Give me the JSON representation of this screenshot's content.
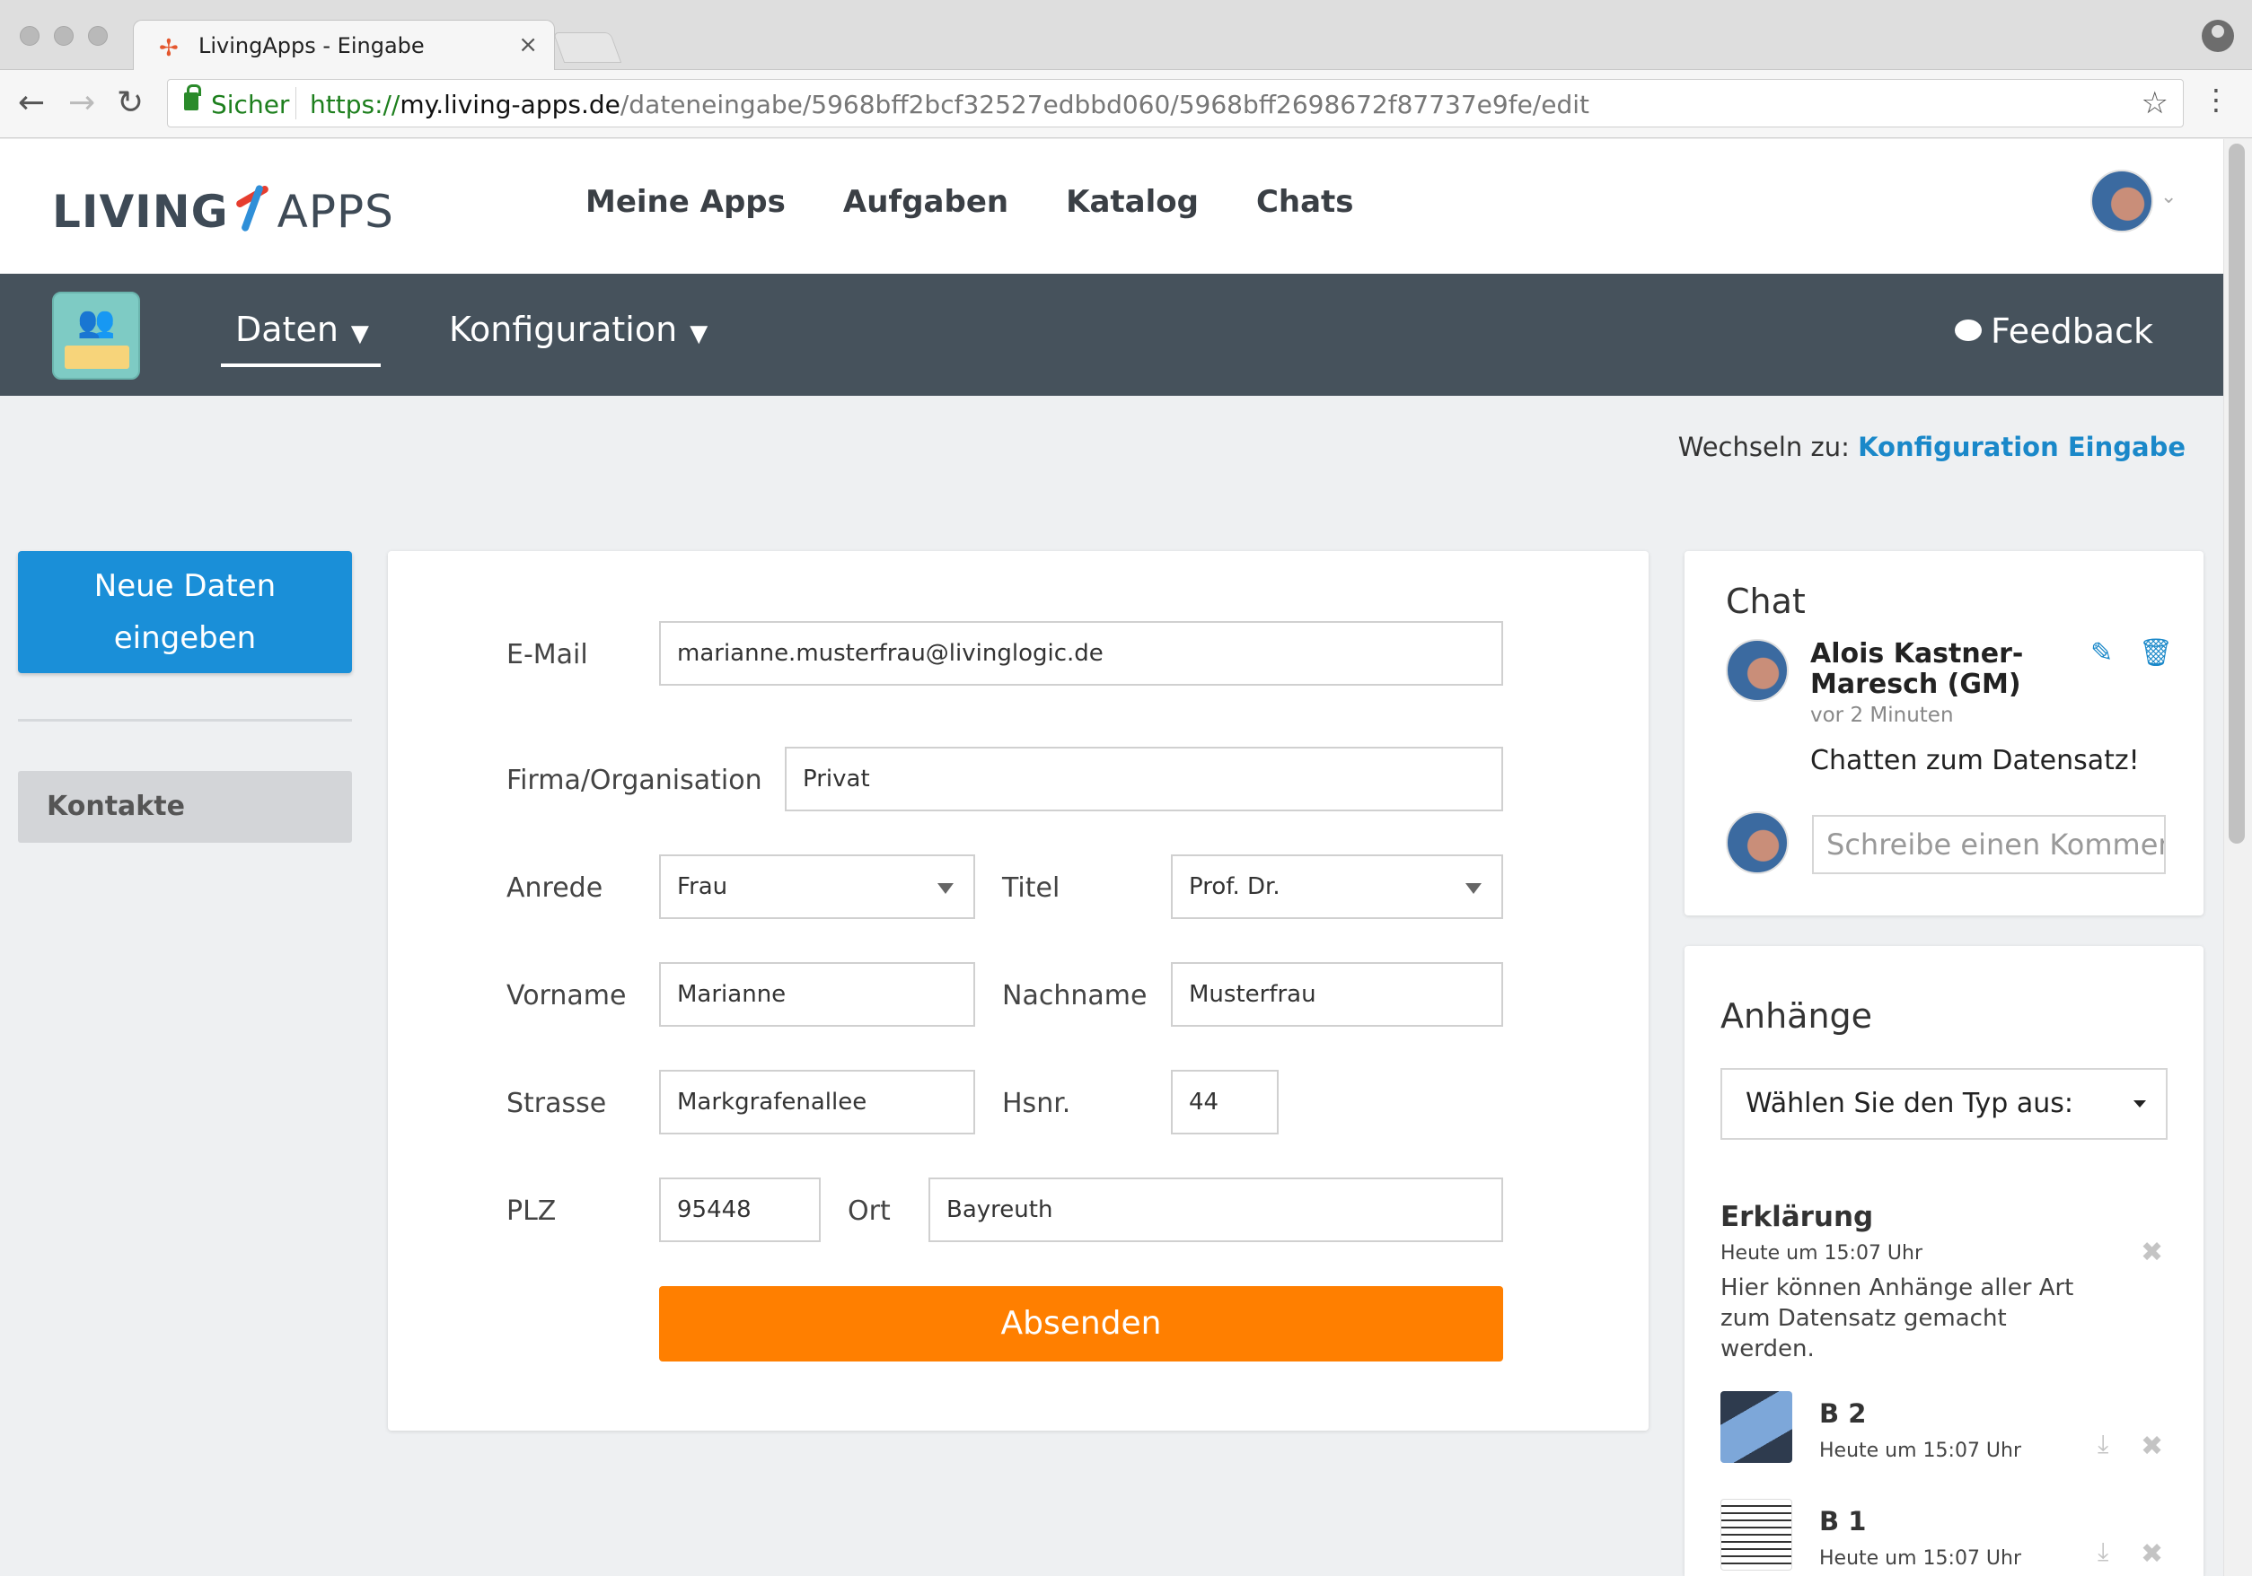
{
  "browser": {
    "tab_title": "LivingApps - Eingabe",
    "tab_close": "×",
    "secure_label": "Sicher",
    "url_protocol": "https://",
    "url_host": "my.living-apps.de",
    "url_path": "/dateneingabe/5968bff2bcf32527edbbd060/5968bff2698672f87737e9fe/edit",
    "back_icon": "arrow-left-icon",
    "forward_icon": "arrow-right-icon",
    "reload_icon": "reload-icon",
    "bookmark_icon": "star-icon"
  },
  "header": {
    "logo_living": "LIVING",
    "logo_apps": "APPS",
    "nav": [
      "Meine Apps",
      "Aufgaben",
      "Katalog",
      "Chats"
    ]
  },
  "subnav": {
    "daten": "Daten",
    "konfiguration": "Konfiguration",
    "feedback": "Feedback"
  },
  "switch": {
    "prefix": "Wechseln zu:",
    "link": "Konfiguration Eingabe"
  },
  "sidebar": {
    "new_button_line1": "Neue Daten",
    "new_button_line2": "eingeben",
    "item": "Kontakte"
  },
  "form": {
    "email_label": "E-Mail",
    "email_value": "marianne.musterfrau@livinglogic.de",
    "firma_label": "Firma/Organisation",
    "firma_value": "Privat",
    "anrede_label": "Anrede",
    "anrede_value": "Frau",
    "titel_label": "Titel",
    "titel_value": "Prof. Dr.",
    "vorname_label": "Vorname",
    "vorname_value": "Marianne",
    "nachname_label": "Nachname",
    "nachname_value": "Musterfrau",
    "strasse_label": "Strasse",
    "strasse_value": "Markgrafenallee",
    "hsnr_label": "Hsnr.",
    "hsnr_value": "44",
    "plz_label": "PLZ",
    "plz_value": "95448",
    "ort_label": "Ort",
    "ort_value": "Bayreuth",
    "submit_label": "Absenden"
  },
  "chat": {
    "title": "Chat",
    "author_line1": "Alois Kastner-",
    "author_line2": "Maresch (GM)",
    "time": "vor 2 Minuten",
    "message": "Chatten zum Datensatz!",
    "input_placeholder": "Schreibe einen Kommentar"
  },
  "attachments": {
    "title": "Anhänge",
    "type_select": "Wählen Sie den Typ aus:",
    "note_title": "Erklärung",
    "note_time": "Heute um 15:07 Uhr",
    "note_text": "Hier können Anhänge aller Art zum Datensatz gemacht werden.",
    "files": [
      {
        "name": "B 2",
        "time": "Heute um 15:07 Uhr"
      },
      {
        "name": "B 1",
        "time": "Heute um 15:07 Uhr"
      }
    ]
  },
  "colors": {
    "primary": "#1a8fd8",
    "submit": "#ff7f00",
    "subnav_bg": "#46525c",
    "link": "#1a88c9"
  }
}
